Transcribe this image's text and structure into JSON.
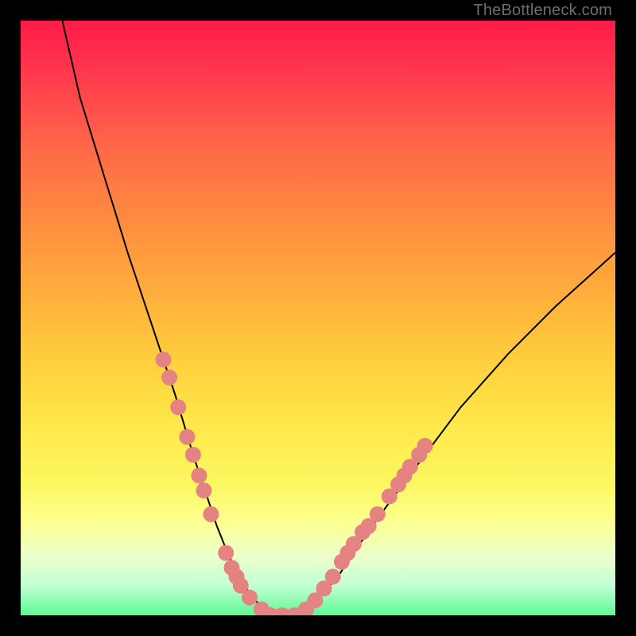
{
  "attribution": "TheBottleneck.com",
  "chart_data": {
    "type": "line",
    "title": "",
    "xlabel": "",
    "ylabel": "",
    "xlim": [
      0,
      100
    ],
    "ylim": [
      0,
      100
    ],
    "series": [
      {
        "name": "curve",
        "x": [
          7,
          10,
          14,
          18,
          22,
          26,
          29,
          31,
          33,
          35,
          37,
          39,
          42,
          45,
          49,
          53,
          57,
          62,
          68,
          74,
          82,
          90,
          100
        ],
        "y": [
          100,
          87,
          74,
          61,
          49,
          37,
          27,
          21,
          15,
          10,
          6,
          3,
          0,
          0,
          2,
          6,
          12,
          19,
          27,
          35,
          44,
          52,
          61
        ]
      }
    ],
    "markers": {
      "name": "highlighted-points",
      "color": "#e58282",
      "points": [
        {
          "x": 24,
          "y": 43
        },
        {
          "x": 25,
          "y": 40
        },
        {
          "x": 26.5,
          "y": 35
        },
        {
          "x": 28,
          "y": 30
        },
        {
          "x": 29,
          "y": 27
        },
        {
          "x": 30,
          "y": 23.5
        },
        {
          "x": 30.8,
          "y": 21
        },
        {
          "x": 32,
          "y": 17
        },
        {
          "x": 34.5,
          "y": 10.5
        },
        {
          "x": 35.5,
          "y": 8
        },
        {
          "x": 36.3,
          "y": 6.5
        },
        {
          "x": 37,
          "y": 5
        },
        {
          "x": 38.5,
          "y": 3
        },
        {
          "x": 40.5,
          "y": 1
        },
        {
          "x": 42,
          "y": 0
        },
        {
          "x": 44,
          "y": 0
        },
        {
          "x": 46,
          "y": 0
        },
        {
          "x": 48,
          "y": 1
        },
        {
          "x": 49.5,
          "y": 2.5
        },
        {
          "x": 51,
          "y": 4.5
        },
        {
          "x": 52.5,
          "y": 6.5
        },
        {
          "x": 54,
          "y": 9
        },
        {
          "x": 55,
          "y": 10.5
        },
        {
          "x": 56,
          "y": 12
        },
        {
          "x": 57.5,
          "y": 14
        },
        {
          "x": 58.5,
          "y": 15
        },
        {
          "x": 60,
          "y": 17
        },
        {
          "x": 62,
          "y": 20
        },
        {
          "x": 63.5,
          "y": 22
        },
        {
          "x": 64.5,
          "y": 23.5
        },
        {
          "x": 65.5,
          "y": 25
        },
        {
          "x": 67,
          "y": 27
        },
        {
          "x": 68,
          "y": 28.5
        }
      ]
    }
  }
}
